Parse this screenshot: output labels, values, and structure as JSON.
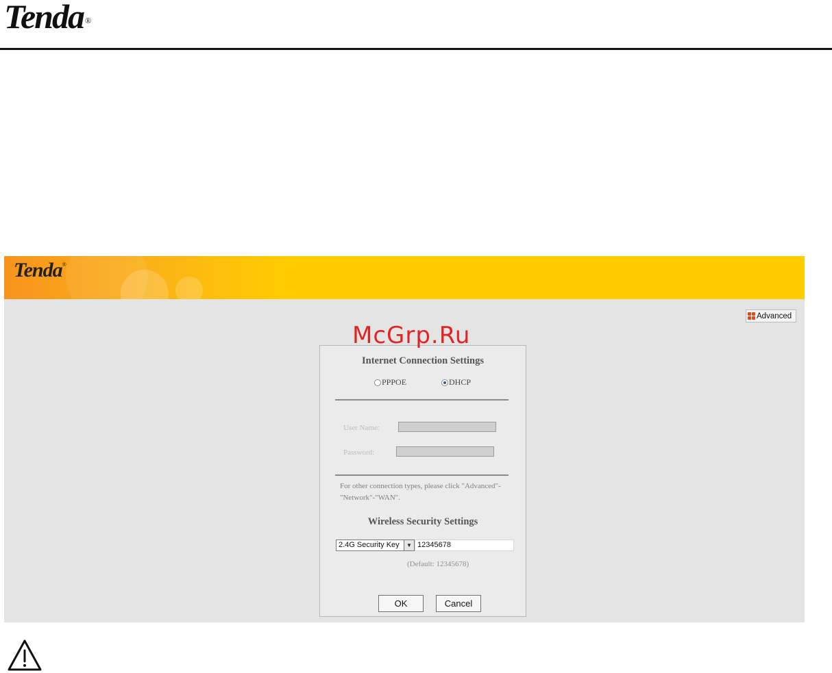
{
  "document": {
    "logo": "Tenda",
    "logo_mark": "®"
  },
  "router_ui": {
    "banner_logo": "Tenda",
    "banner_logo_mark": "®",
    "advanced_button": "Advanced",
    "internet_section": {
      "title": "Internet Connection Settings",
      "options": [
        "PPPOE",
        "DHCP"
      ],
      "selected": "DHCP",
      "user_name_label": "User Name:",
      "user_name_value": "",
      "password_label": "Password:",
      "password_value": "",
      "note": "For other connection types, please click \"Advanced\"-\"Network\"-\"WAN\"."
    },
    "wireless_section": {
      "title": "Wireless Security Settings",
      "key_select_value": "2.4G Security Key",
      "key_value": "12345678",
      "default_note": "(Default: 12345678)"
    },
    "buttons": {
      "ok": "OK",
      "cancel": "Cancel"
    }
  },
  "watermark": "McGrp.Ru",
  "icons": {
    "advanced": "advanced-grid-icon",
    "dropdown": "chevron-down-icon",
    "caution": "warning-triangle-icon"
  },
  "colors": {
    "banner_orange": "#f7941d",
    "banner_yellow": "#ffcc00",
    "panel_bg": "#ebebeb",
    "page_bg": "#e4e4e4",
    "watermark": "#e02424"
  }
}
